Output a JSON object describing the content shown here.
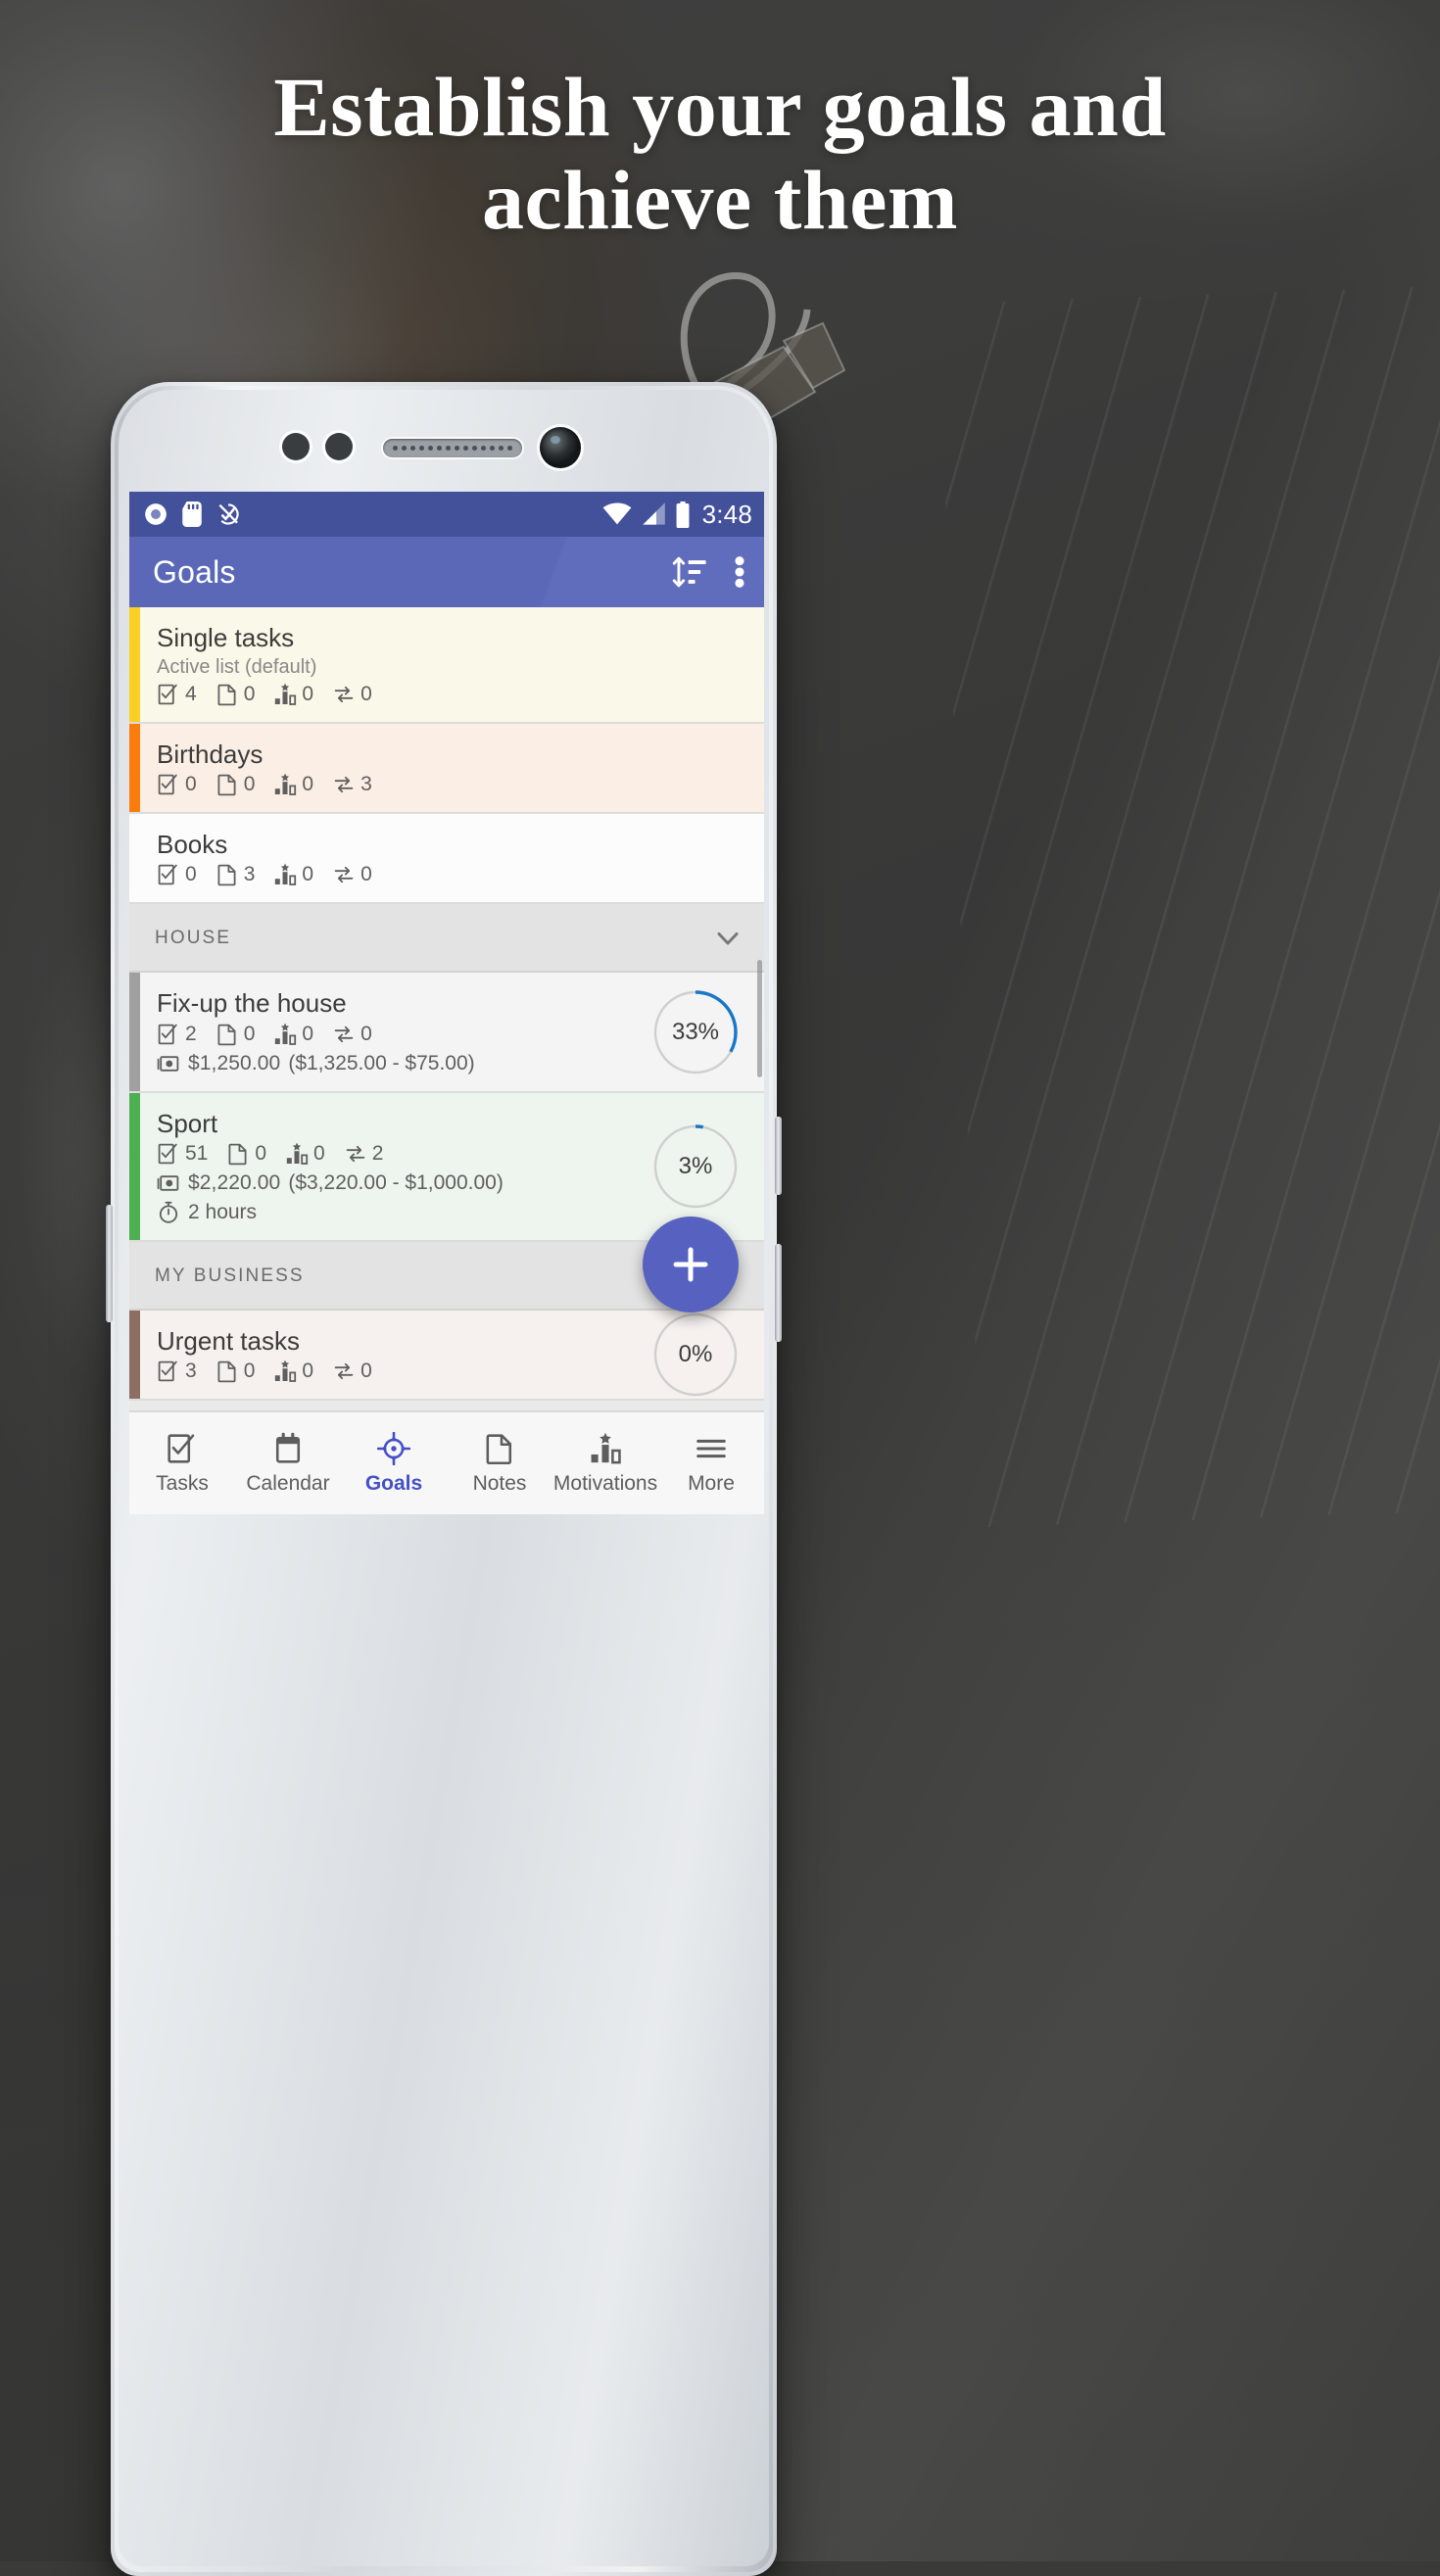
{
  "headline": "Establish your goals and\nachieve them",
  "phone": {
    "status_bar": {
      "time": "3:48",
      "left_icons": [
        "record-icon",
        "sd-card-icon",
        "sync-disabled-icon"
      ],
      "right_icons": [
        "wifi-icon",
        "cell-signal-icon",
        "battery-icon"
      ]
    },
    "app_bar": {
      "title": "Goals",
      "sort_icon": "sort-icon",
      "overflow_icon": "more-vertical-icon"
    },
    "accent_color": "#5b68b8",
    "status_bar_color": "#43509a",
    "progress_arc_color": "#1878c8",
    "fab": {
      "icon": "plus-icon",
      "color": "#5762c0"
    },
    "list": [
      {
        "type": "goal",
        "title": "Single tasks",
        "subtitle": "Active list (default)",
        "accent": "#f9cf23",
        "bg": "#faf8e8",
        "stats": {
          "tasks": "4",
          "notes": "0",
          "motivations": "0",
          "repeats": "0"
        },
        "progress": null,
        "money": null,
        "time": null
      },
      {
        "type": "goal",
        "title": "Birthdays",
        "subtitle": null,
        "accent": "#f97c0d",
        "bg": "#fbeee4",
        "stats": {
          "tasks": "0",
          "notes": "0",
          "motivations": "0",
          "repeats": "3"
        },
        "progress": null,
        "money": null,
        "time": null
      },
      {
        "type": "goal",
        "title": "Books",
        "subtitle": null,
        "accent": "#ffffff",
        "bg": "#fcfcfc",
        "stats": {
          "tasks": "0",
          "notes": "3",
          "motivations": "0",
          "repeats": "0"
        },
        "progress": null,
        "money": null,
        "time": null
      },
      {
        "type": "section",
        "title": "HOUSE",
        "chevron": "chevron-down-icon"
      },
      {
        "type": "goal",
        "title": "Fix-up the house",
        "subtitle": null,
        "accent": "#a0a0a0",
        "bg": "#f4f4f4",
        "stats": {
          "tasks": "2",
          "notes": "0",
          "motivations": "0",
          "repeats": "0"
        },
        "progress": "33%",
        "progress_value": 33,
        "money": "$1,250.00",
        "money_detail": "($1,325.00 - $75.00)",
        "time": null
      },
      {
        "type": "goal",
        "title": "Sport",
        "subtitle": null,
        "accent": "#4caf50",
        "bg": "#eef4ee",
        "stats": {
          "tasks": "51",
          "notes": "0",
          "motivations": "0",
          "repeats": "2"
        },
        "progress": "3%",
        "progress_value": 3,
        "money": "$2,220.00",
        "money_detail": "($3,220.00 - $1,000.00)",
        "time": "2 hours"
      },
      {
        "type": "section",
        "title": "MY BUSINESS",
        "chevron": "chevron-down-icon"
      },
      {
        "type": "goal",
        "title": "Urgent tasks",
        "subtitle": null,
        "accent": "#8d6e63",
        "bg": "#f6f1ef",
        "stats": {
          "tasks": "3",
          "notes": "0",
          "motivations": "0",
          "repeats": "0"
        },
        "progress": "0%",
        "progress_value": 0,
        "money": null,
        "time": null
      }
    ],
    "bottom_nav": [
      {
        "label": "Tasks",
        "icon": "tasks-check-icon",
        "active": false
      },
      {
        "label": "Calendar",
        "icon": "calendar-icon",
        "active": false
      },
      {
        "label": "Goals",
        "icon": "target-icon",
        "active": true
      },
      {
        "label": "Notes",
        "icon": "note-page-icon",
        "active": false
      },
      {
        "label": "Motivations",
        "icon": "bar-chart-star-icon",
        "active": false
      },
      {
        "label": "More",
        "icon": "hamburger-menu-icon",
        "active": false
      }
    ]
  }
}
